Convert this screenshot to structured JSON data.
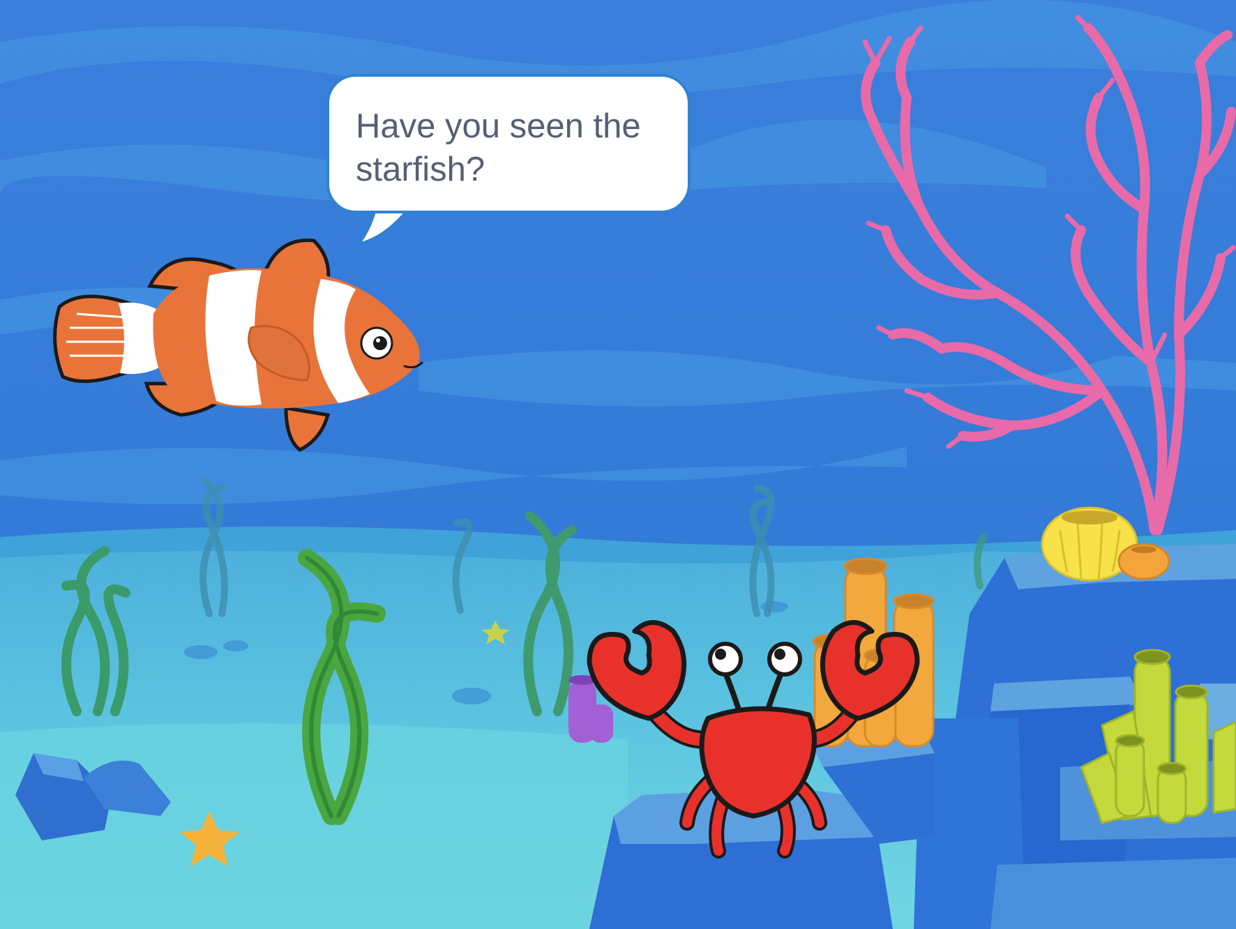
{
  "stage": {
    "background": "underwater-scene",
    "colors": {
      "water": "#3579d8",
      "sand": "#6ccfe0",
      "bubble_border": "#2f82d0",
      "bubble_text": "#575e75"
    }
  },
  "sprites": {
    "fish": {
      "name": "clownfish",
      "speech": "Have you seen the starfish?"
    },
    "crab": {
      "name": "crab"
    }
  }
}
